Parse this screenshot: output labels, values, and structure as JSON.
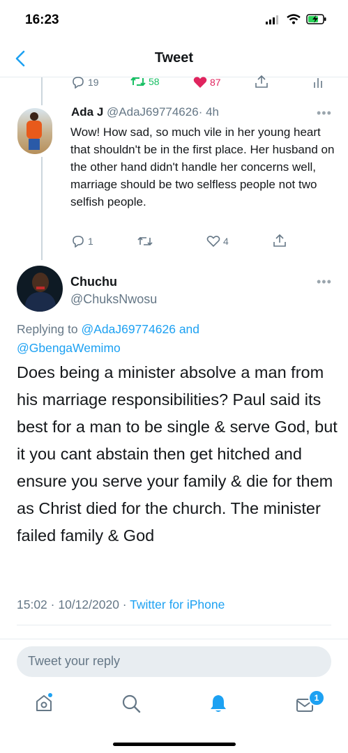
{
  "status_bar": {
    "time": "16:23"
  },
  "nav": {
    "title": "Tweet"
  },
  "prev_actions": {
    "replies": "19",
    "retweets": "58",
    "likes": "87"
  },
  "reply_tweet": {
    "name": "Ada J",
    "handle": "@AdaJ69774626",
    "time": "· 4h",
    "text": "Wow! How sad, so much vile in her young heart that shouldn't be in the first place. Her husband on the other hand didn't handle her concerns well, marriage should be two selfless people not two selfish people.",
    "replies": "1",
    "likes": "4"
  },
  "main_tweet": {
    "name": "Chuchu",
    "handle": "@ChuksNwosu",
    "replying_prefix": "Replying to",
    "replying_user1": "@AdaJ69774626",
    "replying_and": "and",
    "replying_user2": "@GbengaWemimo",
    "text": "Does being a minister absolve a man from his marriage responsibilities? Paul said its best for a man to be single & serve God, but it you cant abstain then get hitched and ensure you serve your family & die for them as Christ died for the church. The minister failed family & God",
    "timestamp": "15:02 · 10/12/2020 ·",
    "source": "Twitter for iPhone"
  },
  "reply_box": {
    "placeholder": "Tweet your reply"
  },
  "tabbar": {
    "messages_badge": "1"
  },
  "colors": {
    "accent": "#1da1f2",
    "retweet": "#17bf63",
    "like": "#e0245e"
  }
}
